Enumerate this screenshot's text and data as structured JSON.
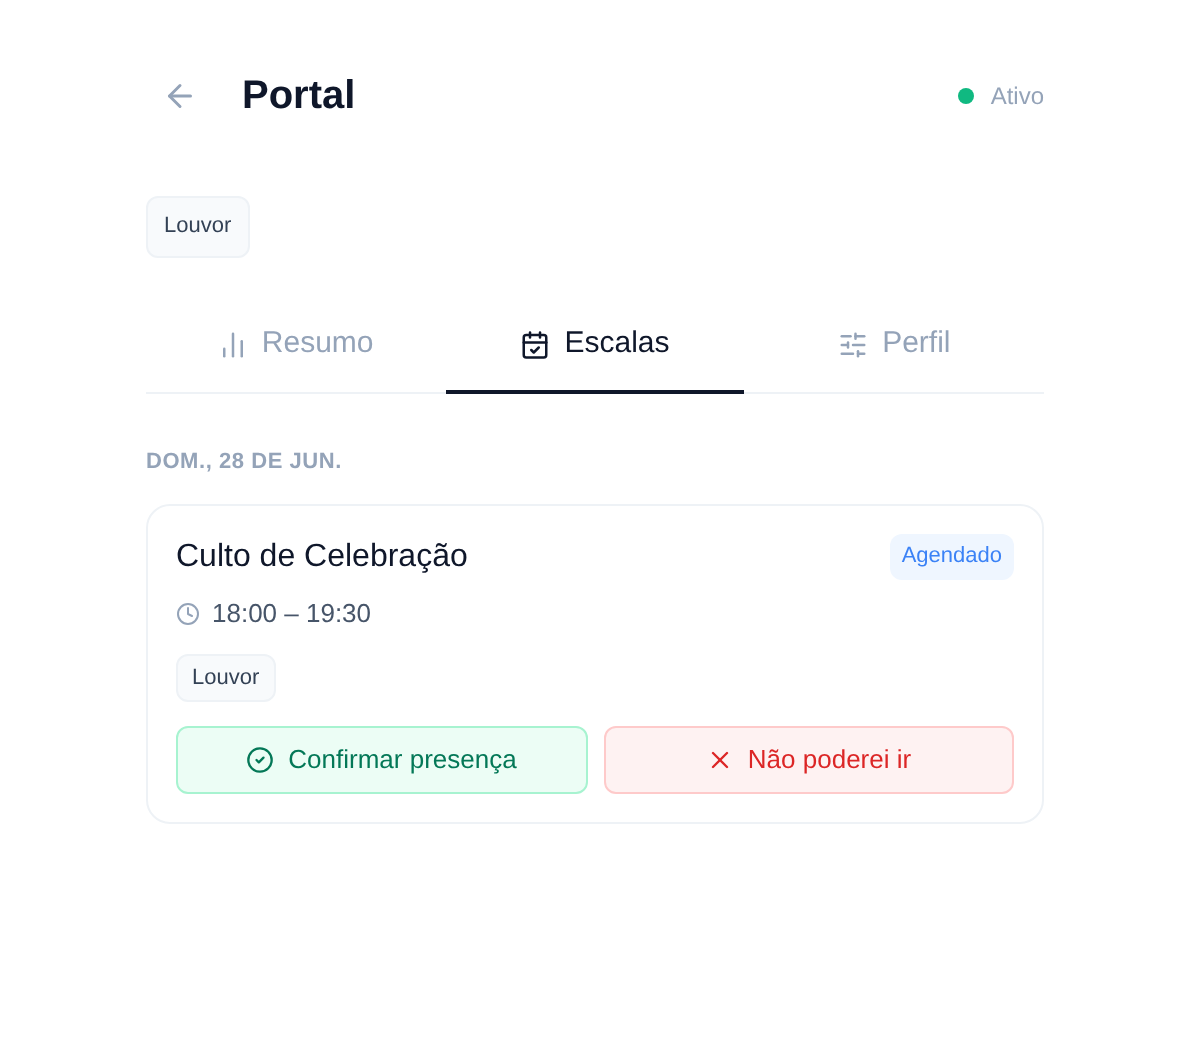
{
  "header": {
    "title": "Portal",
    "status": "Ativo"
  },
  "ministry_tag": "Louvor",
  "tabs": [
    {
      "kind": "summary",
      "label": "Resumo",
      "selected": false
    },
    {
      "kind": "schedule",
      "label": "Escalas",
      "selected": true
    },
    {
      "kind": "profile",
      "label": "Perfil",
      "selected": false
    }
  ],
  "date_heading": "DOM., 28 DE JUN.",
  "events": [
    {
      "title": "Culto de Celebração",
      "status": "Agendado",
      "time": "18:00 – 19:30",
      "tag": "Louvor",
      "actions": [
        {
          "kind": "confirm",
          "label": "Confirmar presença"
        },
        {
          "kind": "decline",
          "label": "Não poderei ir"
        }
      ]
    }
  ]
}
